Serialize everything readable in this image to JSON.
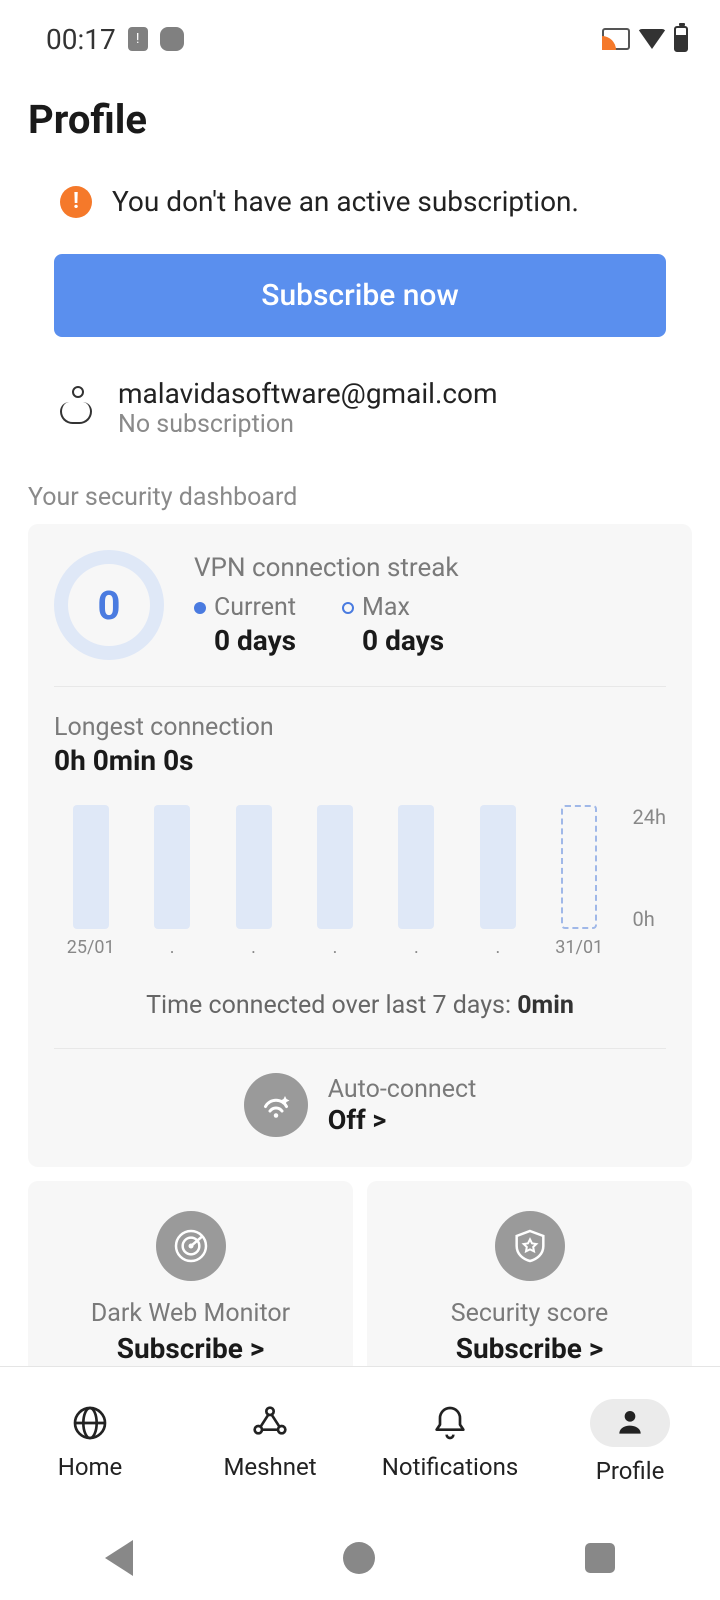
{
  "status_bar": {
    "time": "00:17"
  },
  "page_title": "Profile",
  "alert": {
    "text": "You don't have an active subscription."
  },
  "subscribe_button": "Subscribe now",
  "user": {
    "email": "malavidasoftware@gmail.com",
    "subscription": "No subscription"
  },
  "dashboard": {
    "label": "Your security dashboard",
    "streak": {
      "title": "VPN connection streak",
      "circle_value": "0",
      "current_label": "Current",
      "current_value": "0 days",
      "max_label": "Max",
      "max_value": "0 days"
    },
    "longest": {
      "label": "Longest connection",
      "value": "0h 0min 0s"
    },
    "summary_prefix": "Time connected over last 7 days: ",
    "summary_value": "0min",
    "auto_connect": {
      "label": "Auto-connect",
      "value": "Off >"
    }
  },
  "features": {
    "darkweb": {
      "title": "Dark Web Monitor",
      "action": "Subscribe >"
    },
    "score": {
      "title": "Security score",
      "action": "Subscribe >"
    }
  },
  "nav": {
    "home": "Home",
    "meshnet": "Meshnet",
    "notifications": "Notifications",
    "profile": "Profile"
  },
  "chart_data": {
    "type": "bar",
    "categories": [
      "25/01",
      ".",
      ".",
      ".",
      ".",
      ".",
      "31/01"
    ],
    "values": [
      0,
      0,
      0,
      0,
      0,
      0,
      0
    ],
    "ylabel": "",
    "xlabel": "",
    "ylim": [
      0,
      24
    ],
    "y_ticks": [
      "24h",
      "0h"
    ],
    "today_index": 6,
    "title": "Time connected over last 7 days"
  }
}
